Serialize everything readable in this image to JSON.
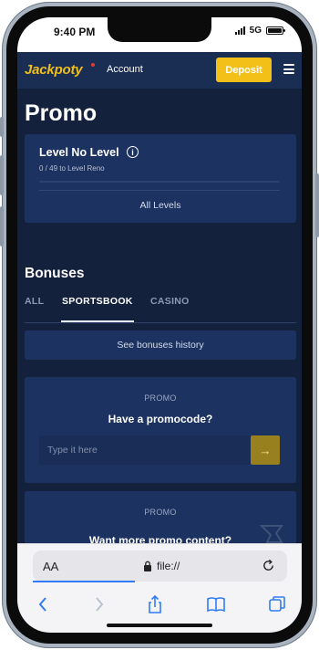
{
  "status_bar": {
    "time": "9:40 PM",
    "network": "5G"
  },
  "header": {
    "logo": "Jackpoty",
    "account": "Account",
    "deposit": "Deposit"
  },
  "page": {
    "title": "Promo"
  },
  "level": {
    "name": "Level No Level",
    "progress_text": "0 / 49 to Level Reno",
    "progress": 0,
    "all_levels": "All Levels"
  },
  "bonuses": {
    "title": "Bonuses",
    "tabs": [
      "ALL",
      "SPORTSBOOK",
      "CASINO"
    ],
    "active_tab": "SPORTSBOOK",
    "history_button": "See bonuses history"
  },
  "promo_card": {
    "label": "PROMO",
    "title": "Have a promocode?",
    "input_placeholder": "Type it here",
    "apply_icon": "arrow-right-icon"
  },
  "more_card": {
    "label": "PROMO",
    "title": "Want more promo content?"
  },
  "browser": {
    "aa": "AA",
    "url": "file://"
  },
  "colors": {
    "accent": "#f3c019",
    "header_bg": "#1a2d52",
    "page_bg": "#13213d",
    "card_bg": "#1c3260"
  }
}
